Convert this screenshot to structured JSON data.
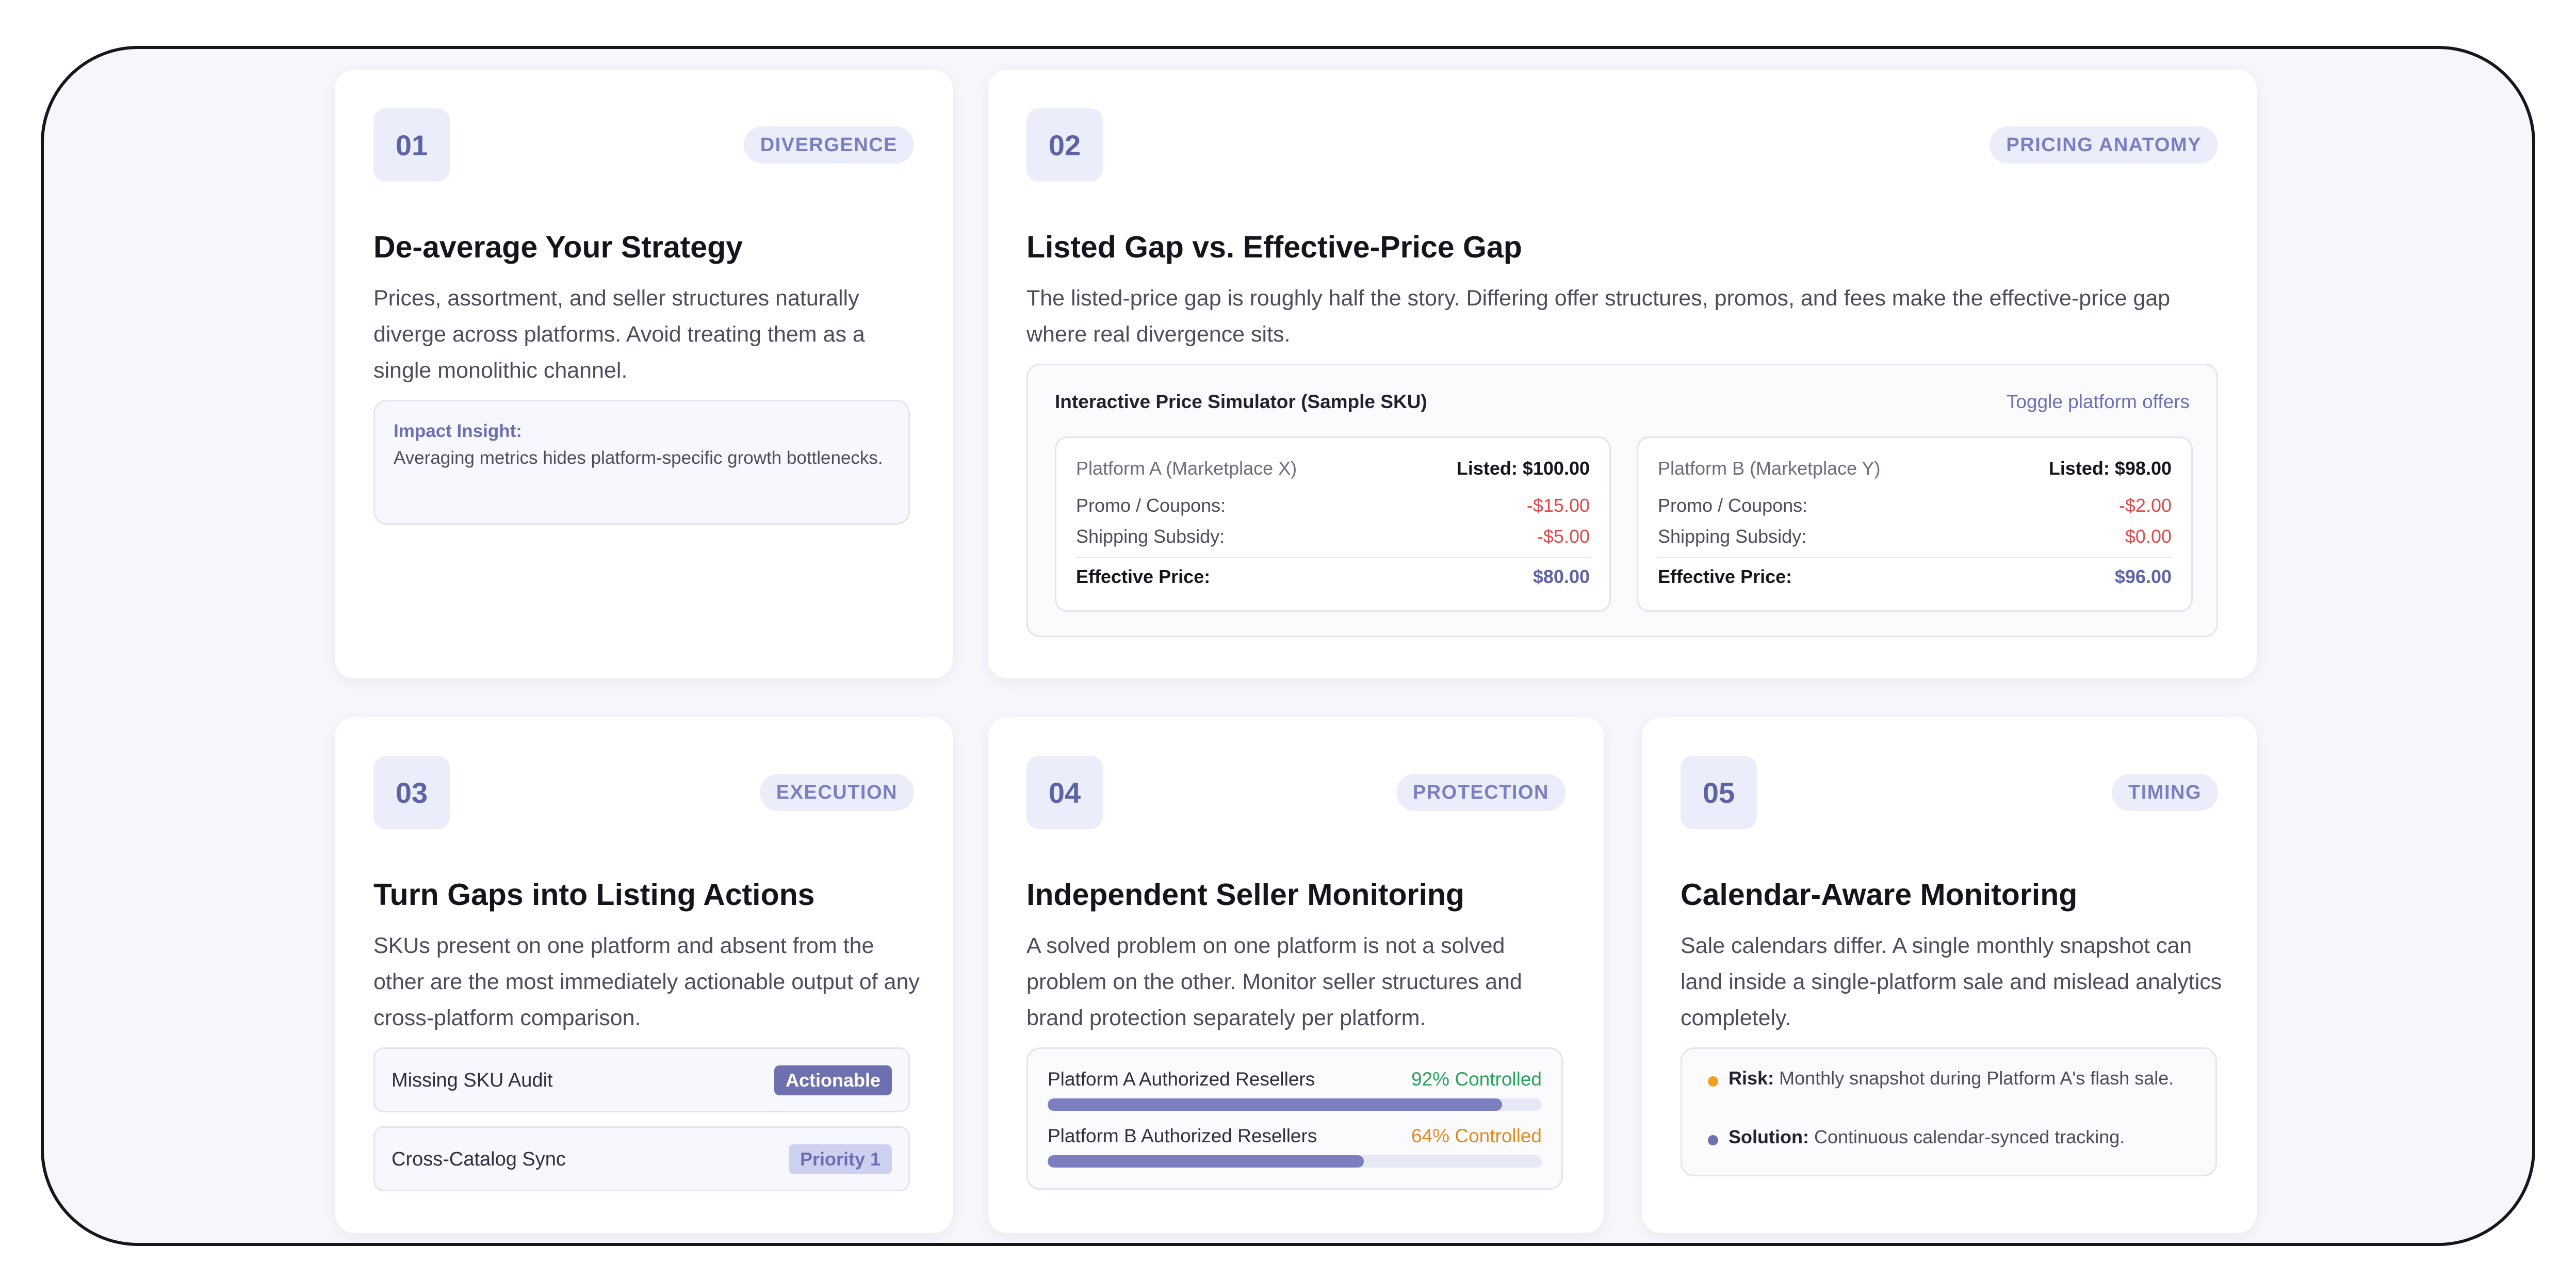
{
  "cards": {
    "c1": {
      "num": "01",
      "tag": "DIVERGENCE",
      "title": "De-average Your Strategy",
      "desc": "Prices, assortment, and seller structures naturally diverge across platforms. Avoid treating them as a single monolithic channel.",
      "insight_title": "Impact Insight:",
      "insight_body": "Averaging metrics hides platform-specific growth bottlenecks."
    },
    "c2": {
      "num": "02",
      "tag": "PRICING ANATOMY",
      "title": "Listed Gap vs. Effective-Price Gap",
      "desc": "The listed-price gap is roughly half the story. Differing offer structures, promos, and fees make the effective-price gap where real divergence sits.",
      "sim_title": "Interactive Price Simulator (Sample SKU)",
      "sim_toggle": "Toggle platform offers",
      "platforms": [
        {
          "name": "Platform A (Marketplace X)",
          "listed": "Listed: $100.00",
          "promo_label": "Promo / Coupons:",
          "promo": "-$15.00",
          "ship_label": "Shipping Subsidy:",
          "ship": "-$5.00",
          "eff_label": "Effective Price:",
          "eff": "$80.00"
        },
        {
          "name": "Platform B (Marketplace Y)",
          "listed": "Listed: $98.00",
          "promo_label": "Promo / Coupons:",
          "promo": "-$2.00",
          "ship_label": "Shipping Subsidy:",
          "ship": "$0.00",
          "eff_label": "Effective Price:",
          "eff": "$96.00"
        }
      ]
    },
    "c3": {
      "num": "03",
      "tag": "EXECUTION",
      "title": "Turn Gaps into Listing Actions",
      "desc": "SKUs present on one platform and absent from the other are the most immediately actionable output of any cross-platform comparison.",
      "rows": [
        {
          "label": "Missing SKU Audit",
          "badge": "Actionable"
        },
        {
          "label": "Cross-Catalog Sync",
          "badge": "Priority 1"
        }
      ]
    },
    "c4": {
      "num": "04",
      "tag": "PROTECTION",
      "title": "Independent Seller Monitoring",
      "desc": "A solved problem on one platform is not a solved problem on the other. Monitor seller structures and brand protection separately per platform.",
      "bars": [
        {
          "label": "Platform A Authorized Resellers",
          "value_label": "92% Controlled",
          "value": 92
        },
        {
          "label": "Platform B Authorized Resellers",
          "value_label": "64% Controlled",
          "value": 64
        }
      ]
    },
    "c5": {
      "num": "05",
      "tag": "TIMING",
      "title": "Calendar-Aware Monitoring",
      "desc": "Sale calendars differ. A single monthly snapshot can land inside a single-platform sale and mislead analytics completely.",
      "risk_label": "Risk:",
      "risk_text": "Monthly snapshot during Platform A's flash sale.",
      "solution_label": "Solution:",
      "solution_text": "Continuous calendar-synced tracking."
    }
  },
  "colors": {
    "accent": "#6e70b0",
    "risk_dot": "#f0a020",
    "solution_dot": "#6e70b0",
    "negative": "#e04a4a",
    "positive": "#28a35a",
    "warning": "#e08a1e"
  }
}
